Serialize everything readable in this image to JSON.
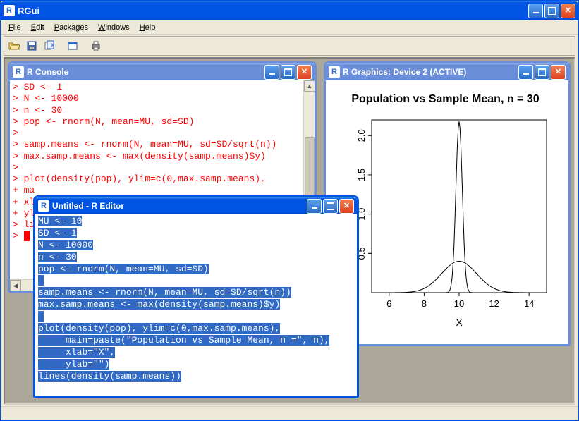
{
  "main": {
    "title": "RGui",
    "menu": [
      "File",
      "Edit",
      "Packages",
      "Windows",
      "Help"
    ]
  },
  "toolbar": {
    "open": "open-icon",
    "save": "save-icon",
    "copy": "copy-icon",
    "window": "window-icon",
    "print": "print-icon"
  },
  "console": {
    "title": "R Console",
    "lines": [
      "> SD <- 1",
      "> N <- 10000",
      "> n <- 30",
      "> pop <- rnorm(N, mean=MU, sd=SD)",
      "> ",
      "> samp.means <- rnorm(N, mean=MU, sd=SD/sqrt(n))",
      "> max.samp.means <- max(density(samp.means)$y)",
      "> ",
      "> plot(density(pop), ylim=c(0,max.samp.means),",
      "+ ma",
      "+ xl",
      "+ yl",
      "> li",
      "> "
    ]
  },
  "editor": {
    "title": "Untitled - R Editor",
    "lines": [
      "MU <- 10",
      "SD <- 1",
      "N <- 10000",
      "n <- 30",
      "pop <- rnorm(N, mean=MU, sd=SD)",
      "",
      "samp.means <- rnorm(N, mean=MU, sd=SD/sqrt(n))",
      "max.samp.means <- max(density(samp.means)$y)",
      "",
      "plot(density(pop), ylim=c(0,max.samp.means),",
      "     main=paste(\"Population vs Sample Mean, n =\", n),",
      "     xlab=\"X\",",
      "     ylab=\"\")",
      "lines(density(samp.means))"
    ]
  },
  "graphics": {
    "title": "R Graphics: Device 2 (ACTIVE)"
  },
  "chart_data": {
    "type": "line",
    "title": "Population vs Sample Mean, n = 30",
    "xlabel": "X",
    "ylabel": "",
    "xlim": [
      5,
      15
    ],
    "ylim": [
      0,
      2.2
    ],
    "x_ticks": [
      6,
      8,
      10,
      12,
      14
    ],
    "y_ticks": [
      0.5,
      1.0,
      1.5,
      2.0
    ],
    "series": [
      {
        "name": "pop",
        "mu": 10,
        "sd": 1,
        "peak": 0.4
      },
      {
        "name": "samp.means",
        "mu": 10,
        "sd": 0.1826,
        "peak": 2.18
      }
    ]
  }
}
